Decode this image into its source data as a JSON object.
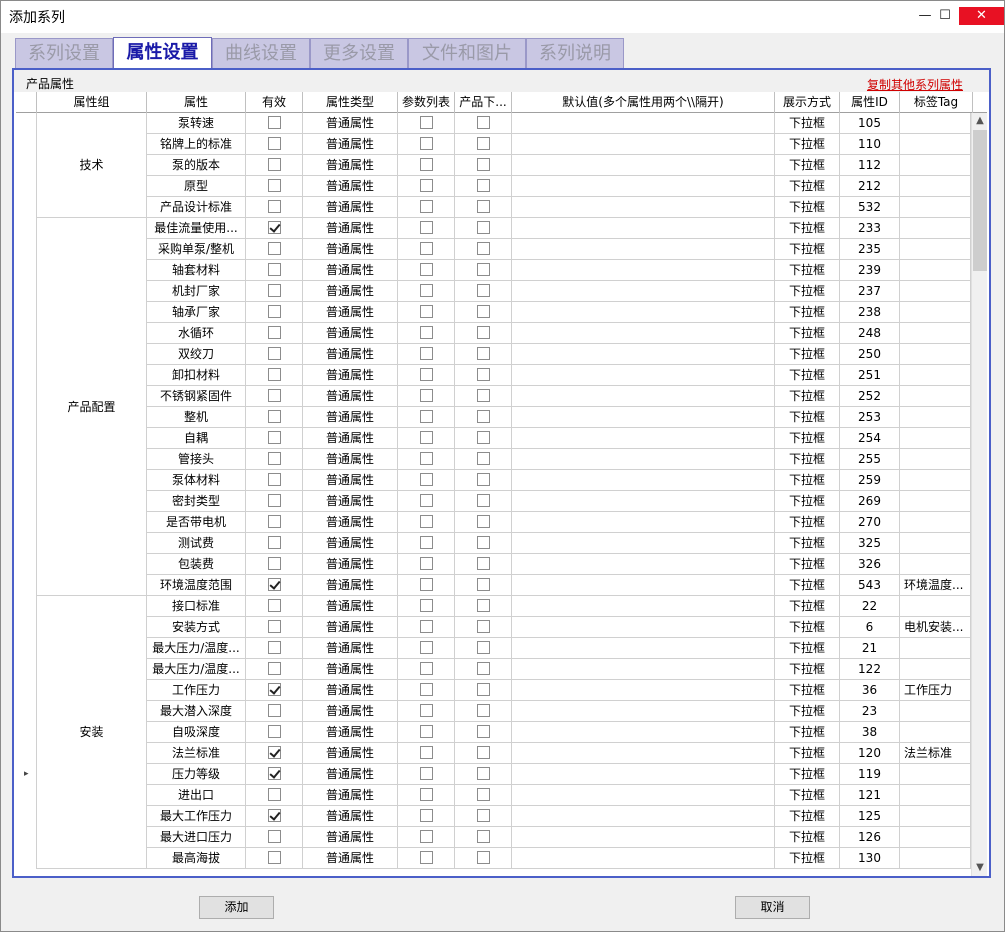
{
  "window": {
    "title": "添加系列",
    "minimize_glyph": "—",
    "maximize_glyph": "☐",
    "close_glyph": "✕"
  },
  "tabs": [
    {
      "label": "系列设置",
      "active": false
    },
    {
      "label": "属性设置",
      "active": true
    },
    {
      "label": "曲线设置",
      "active": false
    },
    {
      "label": "更多设置",
      "active": false
    },
    {
      "label": "文件和图片",
      "active": false
    },
    {
      "label": "系列说明",
      "active": false
    }
  ],
  "panel": {
    "title": "产品属性",
    "copy_link": "复制其他系列属性"
  },
  "columns": [
    "属性组",
    "属性",
    "有效",
    "属性类型",
    "参数列表",
    "产品下...",
    "默认值(多个属性用两个\\\\隔开)",
    "展示方式",
    "属性ID",
    "标签Tag"
  ],
  "groups": [
    {
      "name": "技术",
      "start": 0,
      "count": 5
    },
    {
      "name": "产品配置",
      "start": 5,
      "count": 18
    },
    {
      "name": "安装",
      "start": 23,
      "count": 13
    }
  ],
  "rows": [
    {
      "attr": "泵转速",
      "valid": false,
      "type": "普通属性",
      "param": false,
      "prod": false,
      "default": "",
      "display": "下拉框",
      "id": "105",
      "tag": ""
    },
    {
      "attr": "铭牌上的标准",
      "valid": false,
      "type": "普通属性",
      "param": false,
      "prod": false,
      "default": "",
      "display": "下拉框",
      "id": "110",
      "tag": ""
    },
    {
      "attr": "泵的版本",
      "valid": false,
      "type": "普通属性",
      "param": false,
      "prod": false,
      "default": "",
      "display": "下拉框",
      "id": "112",
      "tag": ""
    },
    {
      "attr": "原型",
      "valid": false,
      "type": "普通属性",
      "param": false,
      "prod": false,
      "default": "",
      "display": "下拉框",
      "id": "212",
      "tag": ""
    },
    {
      "attr": "产品设计标准",
      "valid": false,
      "type": "普通属性",
      "param": false,
      "prod": false,
      "default": "",
      "display": "下拉框",
      "id": "532",
      "tag": ""
    },
    {
      "attr": "最佳流量使用...",
      "valid": true,
      "type": "普通属性",
      "param": false,
      "prod": false,
      "default": "",
      "display": "下拉框",
      "id": "233",
      "tag": ""
    },
    {
      "attr": "采购单泵/整机",
      "valid": false,
      "type": "普通属性",
      "param": false,
      "prod": false,
      "default": "",
      "display": "下拉框",
      "id": "235",
      "tag": ""
    },
    {
      "attr": "轴套材料",
      "valid": false,
      "type": "普通属性",
      "param": false,
      "prod": false,
      "default": "",
      "display": "下拉框",
      "id": "239",
      "tag": ""
    },
    {
      "attr": "机封厂家",
      "valid": false,
      "type": "普通属性",
      "param": false,
      "prod": false,
      "default": "",
      "display": "下拉框",
      "id": "237",
      "tag": ""
    },
    {
      "attr": "轴承厂家",
      "valid": false,
      "type": "普通属性",
      "param": false,
      "prod": false,
      "default": "",
      "display": "下拉框",
      "id": "238",
      "tag": ""
    },
    {
      "attr": "水循环",
      "valid": false,
      "type": "普通属性",
      "param": false,
      "prod": false,
      "default": "",
      "display": "下拉框",
      "id": "248",
      "tag": ""
    },
    {
      "attr": "双绞刀",
      "valid": false,
      "type": "普通属性",
      "param": false,
      "prod": false,
      "default": "",
      "display": "下拉框",
      "id": "250",
      "tag": ""
    },
    {
      "attr": "卸扣材料",
      "valid": false,
      "type": "普通属性",
      "param": false,
      "prod": false,
      "default": "",
      "display": "下拉框",
      "id": "251",
      "tag": ""
    },
    {
      "attr": "不锈钢紧固件",
      "valid": false,
      "type": "普通属性",
      "param": false,
      "prod": false,
      "default": "",
      "display": "下拉框",
      "id": "252",
      "tag": ""
    },
    {
      "attr": "整机",
      "valid": false,
      "type": "普通属性",
      "param": false,
      "prod": false,
      "default": "",
      "display": "下拉框",
      "id": "253",
      "tag": ""
    },
    {
      "attr": "自耦",
      "valid": false,
      "type": "普通属性",
      "param": false,
      "prod": false,
      "default": "",
      "display": "下拉框",
      "id": "254",
      "tag": ""
    },
    {
      "attr": "管接头",
      "valid": false,
      "type": "普通属性",
      "param": false,
      "prod": false,
      "default": "",
      "display": "下拉框",
      "id": "255",
      "tag": ""
    },
    {
      "attr": "泵体材料",
      "valid": false,
      "type": "普通属性",
      "param": false,
      "prod": false,
      "default": "",
      "display": "下拉框",
      "id": "259",
      "tag": ""
    },
    {
      "attr": "密封类型",
      "valid": false,
      "type": "普通属性",
      "param": false,
      "prod": false,
      "default": "",
      "display": "下拉框",
      "id": "269",
      "tag": ""
    },
    {
      "attr": "是否带电机",
      "valid": false,
      "type": "普通属性",
      "param": false,
      "prod": false,
      "default": "",
      "display": "下拉框",
      "id": "270",
      "tag": ""
    },
    {
      "attr": "测试费",
      "valid": false,
      "type": "普通属性",
      "param": false,
      "prod": false,
      "default": "",
      "display": "下拉框",
      "id": "325",
      "tag": ""
    },
    {
      "attr": "包装费",
      "valid": false,
      "type": "普通属性",
      "param": false,
      "prod": false,
      "default": "",
      "display": "下拉框",
      "id": "326",
      "tag": ""
    },
    {
      "attr": "环境温度范围",
      "valid": true,
      "type": "普通属性",
      "param": false,
      "prod": false,
      "default": "",
      "display": "下拉框",
      "id": "543",
      "tag": "环境温度..."
    },
    {
      "attr": "接口标准",
      "valid": false,
      "type": "普通属性",
      "param": false,
      "prod": false,
      "default": "",
      "display": "下拉框",
      "id": "22",
      "tag": ""
    },
    {
      "attr": "安装方式",
      "valid": false,
      "type": "普通属性",
      "param": false,
      "prod": false,
      "default": "",
      "display": "下拉框",
      "id": "6",
      "tag": "电机安装..."
    },
    {
      "attr": "最大压力/温度...",
      "valid": false,
      "type": "普通属性",
      "param": false,
      "prod": false,
      "default": "",
      "display": "下拉框",
      "id": "21",
      "tag": ""
    },
    {
      "attr": "最大压力/温度...",
      "valid": false,
      "type": "普通属性",
      "param": false,
      "prod": false,
      "default": "",
      "display": "下拉框",
      "id": "122",
      "tag": ""
    },
    {
      "attr": "工作压力",
      "valid": true,
      "type": "普通属性",
      "param": false,
      "prod": false,
      "default": "",
      "display": "下拉框",
      "id": "36",
      "tag": "工作压力"
    },
    {
      "attr": "最大潜入深度",
      "valid": false,
      "type": "普通属性",
      "param": false,
      "prod": false,
      "default": "",
      "display": "下拉框",
      "id": "23",
      "tag": ""
    },
    {
      "attr": "自吸深度",
      "valid": false,
      "type": "普通属性",
      "param": false,
      "prod": false,
      "default": "",
      "display": "下拉框",
      "id": "38",
      "tag": ""
    },
    {
      "attr": "法兰标准",
      "valid": true,
      "type": "普通属性",
      "param": false,
      "prod": false,
      "default": "",
      "display": "下拉框",
      "id": "120",
      "tag": "法兰标准"
    },
    {
      "attr": "压力等级",
      "valid": true,
      "type": "普通属性",
      "param": false,
      "prod": false,
      "default": "",
      "display": "下拉框",
      "id": "119",
      "tag": ""
    },
    {
      "attr": "进出口",
      "valid": false,
      "type": "普通属性",
      "param": false,
      "prod": false,
      "default": "",
      "display": "下拉框",
      "id": "121",
      "tag": ""
    },
    {
      "attr": "最大工作压力",
      "valid": true,
      "type": "普通属性",
      "param": false,
      "prod": false,
      "default": "",
      "display": "下拉框",
      "id": "125",
      "tag": ""
    },
    {
      "attr": "最大进口压力",
      "valid": false,
      "type": "普通属性",
      "param": false,
      "prod": false,
      "default": "",
      "display": "下拉框",
      "id": "126",
      "tag": ""
    },
    {
      "attr": "最高海拔",
      "valid": false,
      "type": "普通属性",
      "param": false,
      "prod": false,
      "default": "",
      "display": "下拉框",
      "id": "130",
      "tag": ""
    }
  ],
  "current_row_marker": "▸",
  "buttons": {
    "add": "添加",
    "cancel": "取消"
  }
}
